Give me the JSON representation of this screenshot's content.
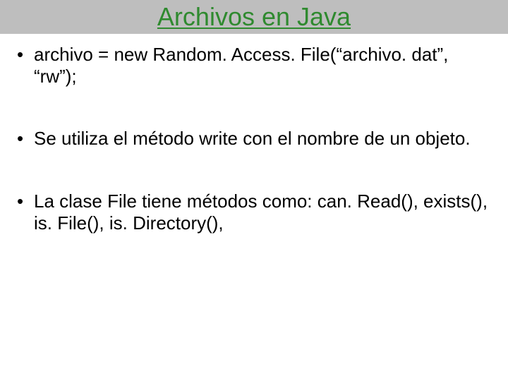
{
  "title": "Archivos en Java",
  "bullets": [
    "archivo = new Random. Access. File(“archivo. dat”, “rw”);",
    "Se utiliza el método write con el nombre de un objeto.",
    "La clase File tiene métodos como: can. Read(), exists(), is. File(), is. Directory(),"
  ]
}
